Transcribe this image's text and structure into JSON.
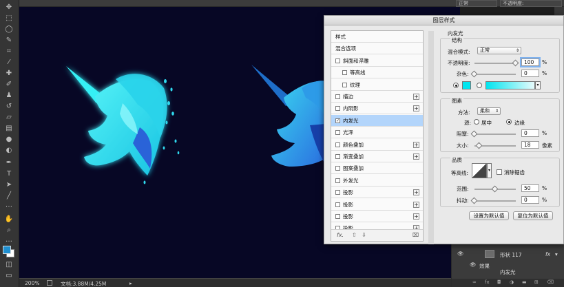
{
  "topbar": {
    "blend_mode": "正常",
    "opacity_label": "不透明度:"
  },
  "statusbar": {
    "zoom": "200%",
    "doc_info": "文档:3.88M/4.25M"
  },
  "dialog": {
    "title": "图层样式",
    "styles_list": [
      {
        "label": "样式",
        "checkbox": false,
        "plus": false,
        "indent": 0,
        "selected": false
      },
      {
        "label": "混合选项",
        "checkbox": false,
        "plus": false,
        "indent": 0,
        "selected": false
      },
      {
        "label": "斜面和浮雕",
        "checkbox": true,
        "checked": false,
        "plus": false,
        "indent": 0,
        "selected": false
      },
      {
        "label": "等高线",
        "checkbox": true,
        "checked": false,
        "plus": false,
        "indent": 1,
        "selected": false
      },
      {
        "label": "纹理",
        "checkbox": true,
        "checked": false,
        "plus": false,
        "indent": 1,
        "selected": false
      },
      {
        "label": "描边",
        "checkbox": true,
        "checked": false,
        "plus": true,
        "indent": 0,
        "selected": false
      },
      {
        "label": "内阴影",
        "checkbox": true,
        "checked": false,
        "plus": true,
        "indent": 0,
        "selected": false
      },
      {
        "label": "内发光",
        "checkbox": true,
        "checked": true,
        "plus": false,
        "indent": 0,
        "selected": true
      },
      {
        "label": "光泽",
        "checkbox": true,
        "checked": false,
        "plus": false,
        "indent": 0,
        "selected": false
      },
      {
        "label": "颜色叠加",
        "checkbox": true,
        "checked": false,
        "plus": true,
        "indent": 0,
        "selected": false
      },
      {
        "label": "渐变叠加",
        "checkbox": true,
        "checked": false,
        "plus": true,
        "indent": 0,
        "selected": false
      },
      {
        "label": "图案叠加",
        "checkbox": true,
        "checked": false,
        "plus": false,
        "indent": 0,
        "selected": false
      },
      {
        "label": "外发光",
        "checkbox": true,
        "checked": false,
        "plus": false,
        "indent": 0,
        "selected": false
      },
      {
        "label": "投影",
        "checkbox": true,
        "checked": false,
        "plus": true,
        "indent": 0,
        "selected": false
      },
      {
        "label": "投影",
        "checkbox": true,
        "checked": false,
        "plus": true,
        "indent": 0,
        "selected": false
      },
      {
        "label": "投影",
        "checkbox": true,
        "checked": false,
        "plus": true,
        "indent": 0,
        "selected": false
      },
      {
        "label": "投影",
        "checkbox": true,
        "checked": false,
        "plus": true,
        "indent": 0,
        "selected": false
      }
    ],
    "footer": {
      "fx": "fx.",
      "up": "⇧",
      "down": "⇩",
      "trash": "🗑"
    },
    "settings": {
      "heading": "内发光",
      "structure": {
        "title": "结构",
        "blend_mode_label": "混合模式:",
        "blend_mode_value": "正常",
        "opacity_label": "不透明度:",
        "opacity_value": "100",
        "opacity_unit": "%",
        "opacity_level": 1.0,
        "noise_label": "杂色:",
        "noise_value": "0",
        "noise_unit": "%",
        "noise_level": 0.0,
        "color": "#00e5ef",
        "gradient_from": "#00e5ef",
        "gradient_to": "#e8fbfc"
      },
      "elements": {
        "title": "图素",
        "method_label": "方法:",
        "method_value": "柔和",
        "source_label": "源:",
        "source_center": "居中",
        "source_edge": "边缘",
        "source_selected": "边缘",
        "choke_label": "阻塞:",
        "choke_value": "0",
        "choke_unit": "%",
        "size_label": "大小:",
        "size_value": "18",
        "size_unit": "像素"
      },
      "quality": {
        "title": "品质",
        "contour_label": "等高线:",
        "antialias_label": "消除锯齿",
        "range_label": "范围:",
        "range_value": "50",
        "range_unit": "%",
        "jitter_label": "抖动:",
        "jitter_value": "0",
        "jitter_unit": "%"
      },
      "set_default_button": "设置为默认值",
      "reset_default_button": "复位为默认值"
    }
  },
  "layers": {
    "layer_name": "形状 117",
    "effects_label": "效果",
    "sub_label": "内发光"
  },
  "colors": {
    "canvas_bg": "#070725",
    "unicorn_cyan": "#2ee6f0",
    "unicorn_blue": "#1f6fd6",
    "foreground_swatch": "#1f8fd0"
  }
}
